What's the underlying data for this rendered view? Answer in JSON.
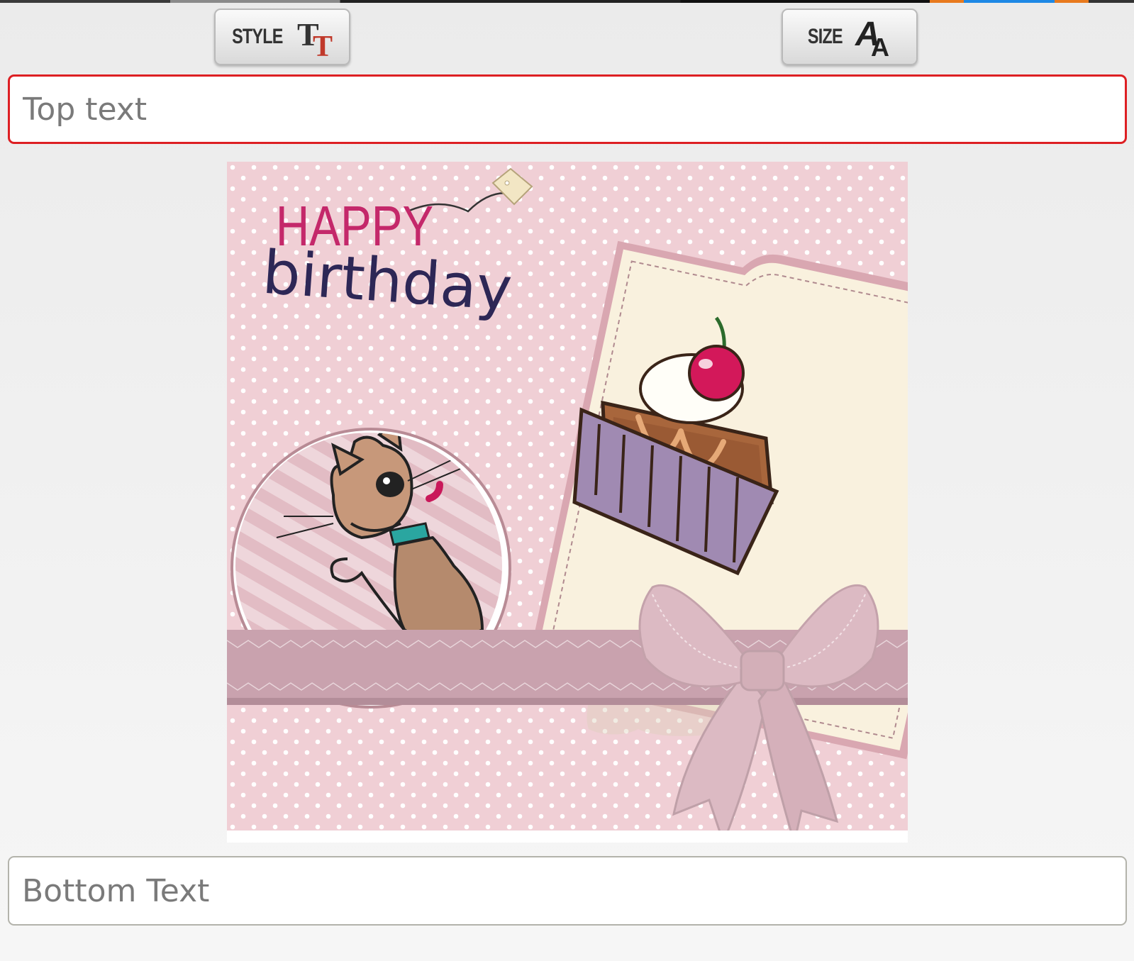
{
  "toolbar": {
    "style_label": "STYLE",
    "style_icon": "text-style-icon",
    "size_label": "SIZE",
    "size_icon": "text-size-icon"
  },
  "inputs": {
    "top_placeholder": "Top text",
    "top_value": "",
    "bottom_placeholder": "Bottom Text",
    "bottom_value": ""
  },
  "card": {
    "line1": "HAPPY",
    "line2": "birthday"
  },
  "colors": {
    "accent_border": "#dd1f23",
    "card_pink": "#f0cfd5",
    "happy_pink": "#c4286a",
    "birthday_navy": "#2d2756",
    "cherry": "#d3185a"
  }
}
